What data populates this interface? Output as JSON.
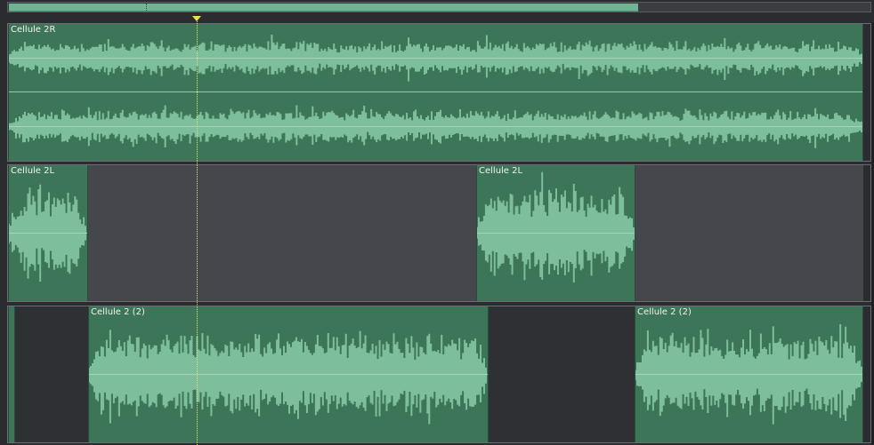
{
  "overview": {
    "visible_fraction": 0.73
  },
  "colors": {
    "clip_fill": "#3d7559",
    "waveform": "#7dbf9c",
    "lane_bg": "#46474c",
    "playhead": "#f0e040"
  },
  "tracks": [
    {
      "clips": [
        {
          "label": "Cellule 2R",
          "start": 0.0,
          "end": 0.992,
          "channels": 2
        }
      ]
    },
    {
      "clips": [
        {
          "label": "Cellule 2L",
          "start": 0.0,
          "end": 0.093,
          "channels": 1
        },
        {
          "label": "Cellule 2L",
          "start": 0.543,
          "end": 0.728,
          "channels": 1
        }
      ]
    },
    {
      "clips": [
        {
          "label": "",
          "start": 0.0,
          "end": 0.008,
          "channels": 1
        },
        {
          "label": "Cellule 2 (2)",
          "start": 0.093,
          "end": 0.557,
          "channels": 1
        },
        {
          "label": "Cellule 2 (2)",
          "start": 0.727,
          "end": 0.992,
          "channels": 1
        }
      ]
    }
  ],
  "playhead": {
    "position": 0.22
  }
}
